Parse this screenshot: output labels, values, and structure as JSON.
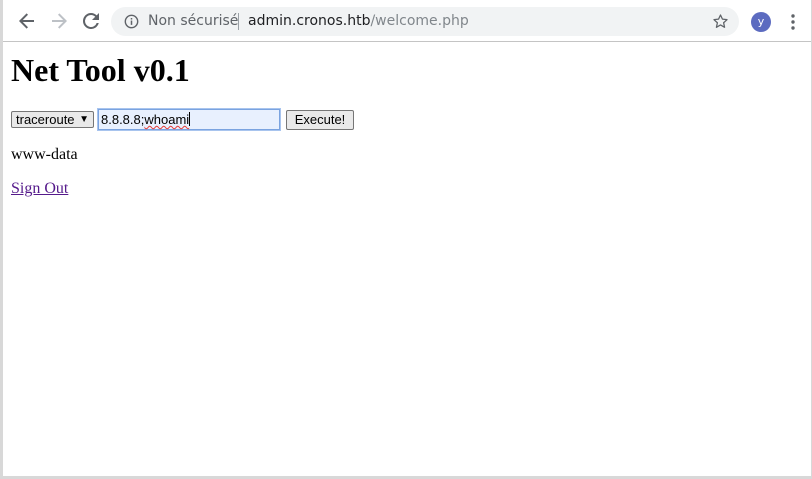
{
  "browser": {
    "security_label": "Non sécurisé",
    "url_host": "admin.cronos.htb",
    "url_path": "/welcome.php",
    "avatar_initial": "y",
    "avatar_color": "#5c6bc0",
    "icons": {
      "back": "arrow-left",
      "forward": "arrow-right",
      "reload": "refresh",
      "info": "info-circle",
      "bookmark": "star-outline",
      "menu": "vertical-dots"
    }
  },
  "page": {
    "title": "Net Tool v0.1",
    "form": {
      "command_select": "traceroute",
      "host_input_prefix": "8.8.8.8;",
      "host_input_misspelled": "whoami",
      "execute_label": "Execute!"
    },
    "output": "www-data",
    "signout_label": "Sign Out"
  },
  "colors": {
    "visited_link": "#551a8b",
    "focused_input_bg": "#e8f0fe",
    "focus_ring": "#7aa3e0"
  }
}
